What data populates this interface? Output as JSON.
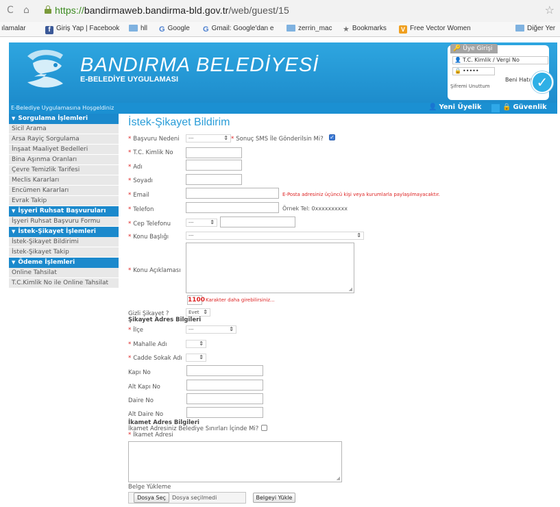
{
  "browser": {
    "url_scheme": "https://",
    "url_host": "bandirmaweb.bandirma-bld.gov.tr",
    "url_path": "/web/guest/15",
    "bookmarks": [
      "ılamalar",
      "Giriş Yap | Facebook",
      "hll",
      "Google",
      "Gmail: Google'dan e",
      "zerrin_mac",
      "Bookmarks",
      "Free Vector Women",
      "Diğer Yer"
    ]
  },
  "header": {
    "brand": "BANDIRMA BELEDİYESİ",
    "subtitle": "E-BELEDİYE UYGULAMASI",
    "welcome": "E-Belediye Uygulamasına Hoşgeldiniz",
    "new_member": "Yeni Üyelik",
    "security": "Güvenlik",
    "login": {
      "tab": "Üye Girişi",
      "id_placeholder": "T.C. Kimlik / Vergi No",
      "password_mask": "•••••",
      "remember": "Beni Hatırla",
      "forgot": "Şifremi Unuttum"
    }
  },
  "sidebar": {
    "sections": [
      {
        "title": "Sorgulama İşlemleri",
        "items": [
          "Sicil Arama",
          "Arsa Rayiç Sorgulama",
          "İnşaat Maaliyet Bedelleri",
          "Bina Aşınma Oranları",
          "Çevre Temizlik Tarifesi",
          "Meclis Kararları",
          "Encümen Kararları",
          "Evrak Takip"
        ]
      },
      {
        "title": "İşyeri Ruhsat Başvuruları",
        "items": [
          "İşyeri Ruhsat Başvuru Formu"
        ]
      },
      {
        "title": "İstek-Şikayet İşlemleri",
        "items": [
          "İstek-Şikayet Bildirimi",
          "İstek-Şikayet Takip"
        ]
      },
      {
        "title": "Ödeme İşlemleri",
        "items": [
          "Online Tahsilat",
          "T.C.Kimlik No ile Online Tahsilat"
        ]
      }
    ]
  },
  "form": {
    "title": "İstek-Şikayet Bildirim",
    "basvuru_nedeni": "Başvuru Nedeni",
    "basvuru_value": "---",
    "sms_question": "Sonuç SMS İle Gönderilsin Mi?",
    "tc": "T.C. Kimlik No",
    "ad": "Adı",
    "soyad": "Soyadı",
    "email": "Email",
    "email_note": "E-Posta adresiniz üçüncü kişi veya kurumlarla paylaşılmayacaktır.",
    "telefon": "Telefon",
    "telefon_hint": "Örnek Tel: 0xxxxxxxxxx",
    "cep": "Cep Telefonu",
    "cep_value": "---",
    "konu_basligi": "Konu Başlığı",
    "konu_value": "---",
    "konu_aciklamasi": "Konu Açıklaması",
    "counter": "1100",
    "counter_note": "Karakter daha girebilirsiniz...",
    "gizli": "Gizli Şikayet ?",
    "gizli_value": "Evet",
    "sikayet_adres": "Şikayet Adres Bilgileri",
    "ilce": "İlçe",
    "ilce_value": "---",
    "mahalle": "Mahalle Adı",
    "cadde": "Cadde Sokak Adı",
    "kapi": "Kapı No",
    "alt_kapi": "Alt Kapı No",
    "daire": "Daire No",
    "alt_daire": "Alt Daire No",
    "ikamet_bilgi": "İkamet Adres Bilgileri",
    "ikamet_question": "İkamet Adresiniz Belediye Sınırları İçinde Mi?",
    "ikamet_adres": "İkamet Adresi",
    "belge": "Belge Yükleme",
    "dosya_sec": "Dosya Seç",
    "dosya_none": "Dosya seçilmedi",
    "belgeyi_yukle": "Belgeyi Yükle"
  }
}
